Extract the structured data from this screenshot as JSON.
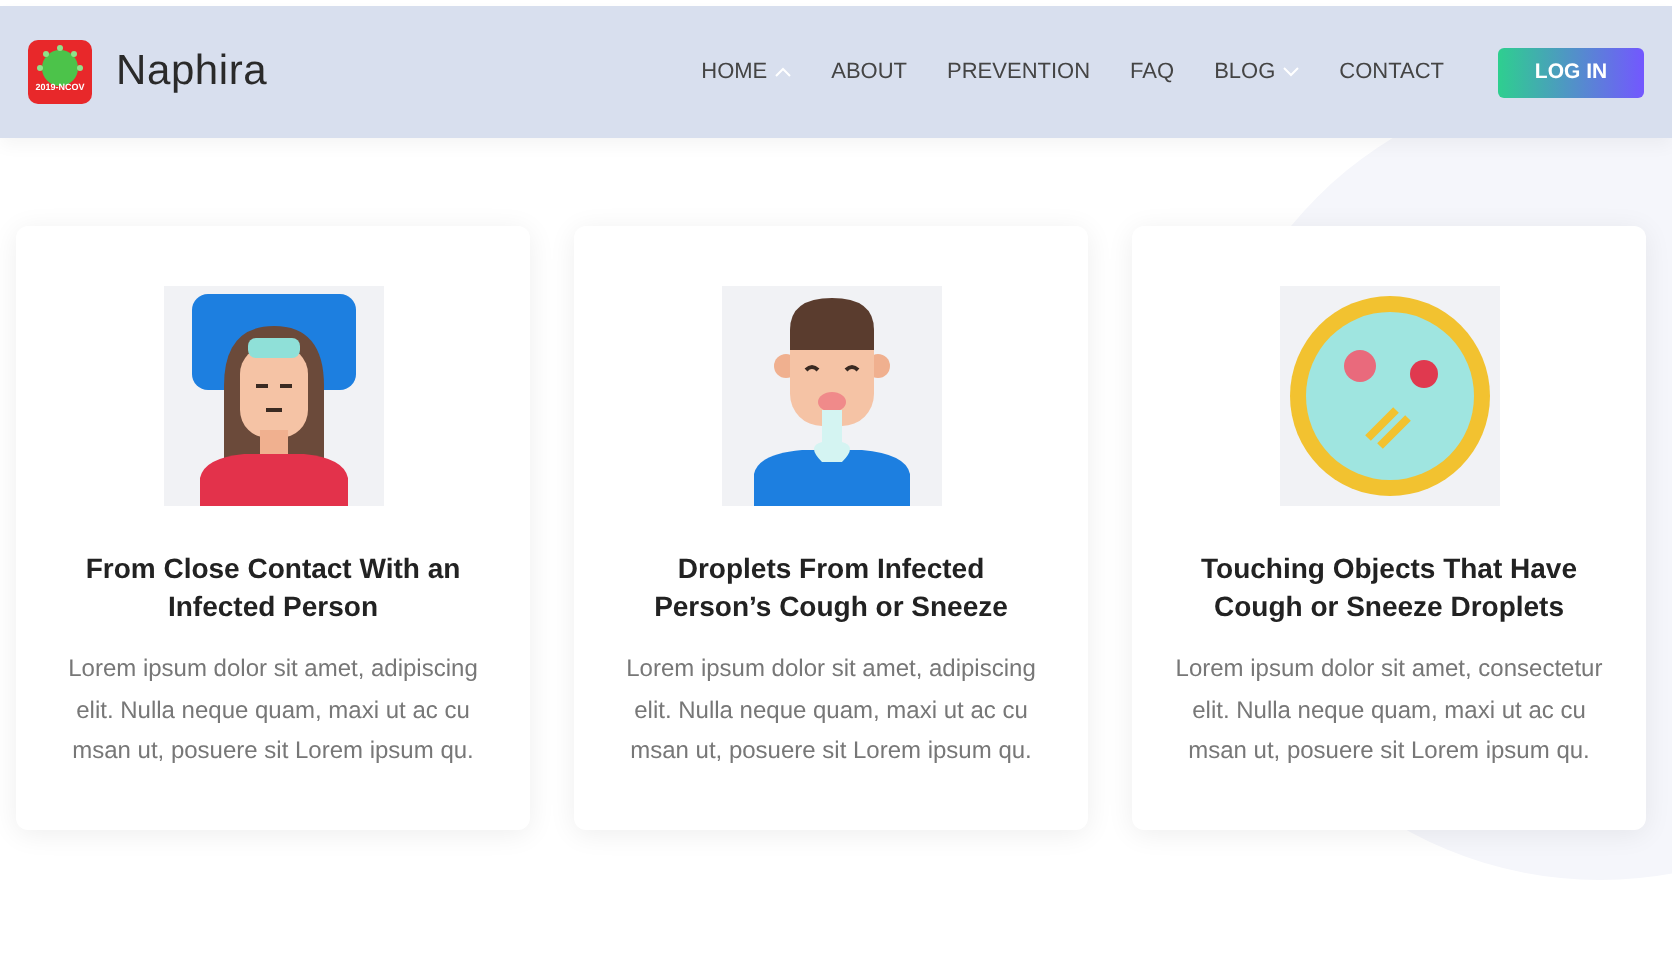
{
  "brand": {
    "logo_text": "2019-NCOV",
    "name": "Naphira"
  },
  "nav": [
    {
      "label": "HOME",
      "dropdown": true,
      "expanded": true
    },
    {
      "label": "ABOUT",
      "dropdown": false,
      "expanded": false
    },
    {
      "label": "PREVENTION",
      "dropdown": false,
      "expanded": false
    },
    {
      "label": "FAQ",
      "dropdown": false,
      "expanded": false
    },
    {
      "label": "BLOG",
      "dropdown": true,
      "expanded": false
    },
    {
      "label": "CONTACT",
      "dropdown": false,
      "expanded": false
    }
  ],
  "login_button": "LOG IN",
  "cards": [
    {
      "kind": "bed",
      "title": "From Close Contact With an Infected Person",
      "text": "Lorem ipsum dolor sit amet, adipiscing elit. Nulla neque quam, maxi ut ac cu msan ut, posuere sit Lorem ipsum qu."
    },
    {
      "kind": "cough",
      "title": "Droplets From Infected Person’s Cough or Sneeze",
      "text": "Lorem ipsum dolor sit amet, adipiscing elit. Nulla neque quam, maxi ut ac cu msan ut, posuere sit Lorem ipsum qu."
    },
    {
      "kind": "dish",
      "title": "Touching Objects That Have Cough or Sneeze Droplets",
      "text": "Lorem ipsum dolor sit amet, consectetur elit. Nulla neque quam, maxi ut ac cu msan ut, posuere sit Lorem ipsum qu."
    }
  ]
}
